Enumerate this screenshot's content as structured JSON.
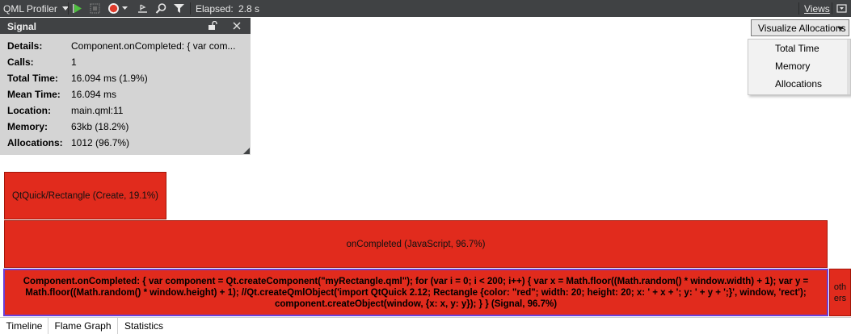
{
  "toolbar": {
    "profiler_label": "QML Profiler",
    "elapsed_label": "Elapsed:",
    "elapsed_value": "2.8 s",
    "views_label": "Views"
  },
  "details": {
    "title": "Signal",
    "rows": [
      {
        "key": "Details:",
        "value": "Component.onCompleted: { var com..."
      },
      {
        "key": "Calls:",
        "value": "1"
      },
      {
        "key": "Total Time:",
        "value": "16.094 ms (1.9%)"
      },
      {
        "key": "Mean Time:",
        "value": "16.094 ms"
      },
      {
        "key": "Location:",
        "value": "main.qml:11"
      },
      {
        "key": "Memory:",
        "value": "63kb (18.2%)"
      },
      {
        "key": "Allocations:",
        "value": "1012 (96.7%)"
      }
    ]
  },
  "visualize": {
    "selected": "Visualize Allocations",
    "options": [
      "Total Time",
      "Memory",
      "Allocations"
    ]
  },
  "flame": {
    "rectangle_label": "QtQuick/Rectangle (Create, 19.1%)",
    "oncompleted_label": "onCompleted (JavaScript, 96.7%)",
    "signal_label": "Component.onCompleted: { var component = Qt.createComponent(\"myRectangle.qml\"); for (var i = 0; i < 200; i++) { var x = Math.floor((Math.random() * window.width) + 1); var y = Math.floor((Math.random() * window.height) + 1); //Qt.createQmlObject('import QtQuick 2.12; Rectangle {color: \"red\"; width: 20; height: 20; x: ' + x + '; y: ' + y + ';}', window, 'rect'); component.createObject(window, {x: x, y: y}); } } (Signal, 96.7%)",
    "others_label": "oth ers"
  },
  "tabs": [
    "Timeline",
    "Flame Graph",
    "Statistics"
  ],
  "colors": {
    "flame": "#e12b1d",
    "toolbar": "#404244",
    "selection": "#6a3fd8"
  }
}
